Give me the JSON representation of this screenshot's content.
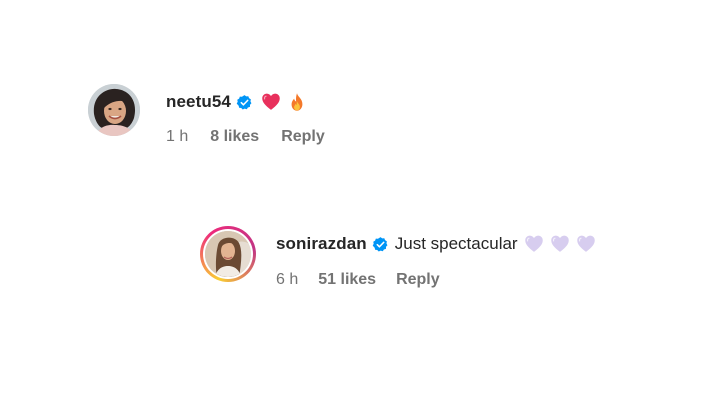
{
  "comments": [
    {
      "username": "neetu54",
      "verified": true,
      "text": "",
      "emojis": [
        "heart-icon",
        "fire-icon"
      ],
      "time": "1 h",
      "likes": "8 likes",
      "reply": "Reply"
    },
    {
      "username": "sonirazdan",
      "verified": true,
      "text": "Just spectacular",
      "emojis": [
        "light-purple-heart-icon",
        "light-purple-heart-icon",
        "light-purple-heart-icon"
      ],
      "time": "6 h",
      "likes": "51 likes",
      "reply": "Reply"
    }
  ],
  "colors": {
    "verified": "#0095f6",
    "meta_text": "#737373",
    "username": "#262626",
    "heart_red": "#e8305c",
    "heart_lavender": "#d7cdef"
  }
}
